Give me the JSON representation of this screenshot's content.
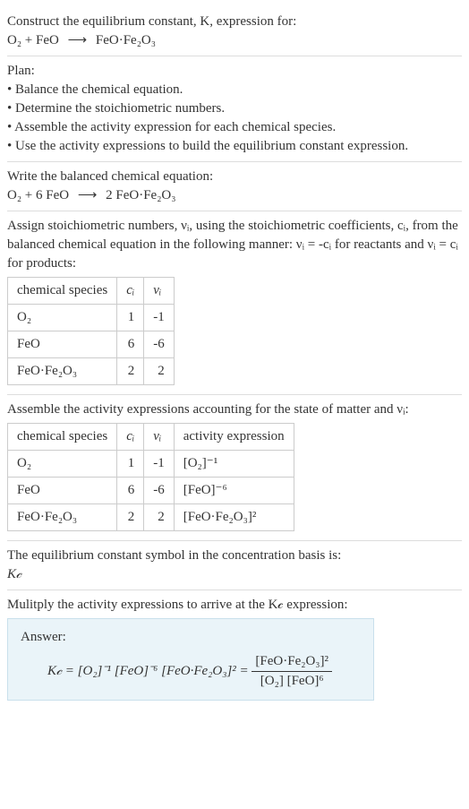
{
  "title": "Construct the equilibrium constant, K, expression for:",
  "unbalanced": {
    "left": "O₂ + FeO",
    "arrow": "⟶",
    "right": "FeO·Fe₂O₃"
  },
  "plan": {
    "heading": "Plan:",
    "items": [
      "• Balance the chemical equation.",
      "• Determine the stoichiometric numbers.",
      "• Assemble the activity expression for each chemical species.",
      "• Use the activity expressions to build the equilibrium constant expression."
    ]
  },
  "balanced": {
    "heading": "Write the balanced chemical equation:",
    "left": "O₂ + 6 FeO",
    "arrow": "⟶",
    "right": "2 FeO·Fe₂O₃"
  },
  "stoich": {
    "heading": "Assign stoichiometric numbers, νᵢ, using the stoichiometric coefficients, cᵢ, from the balanced chemical equation in the following manner: νᵢ = -cᵢ for reactants and νᵢ = cᵢ for products:",
    "cols": [
      "chemical species",
      "cᵢ",
      "νᵢ"
    ],
    "rows": [
      {
        "species": "O₂",
        "c": "1",
        "nu": "-1"
      },
      {
        "species": "FeO",
        "c": "6",
        "nu": "-6"
      },
      {
        "species": "FeO·Fe₂O₃",
        "c": "2",
        "nu": "2"
      }
    ]
  },
  "activity": {
    "heading": "Assemble the activity expressions accounting for the state of matter and νᵢ:",
    "cols": [
      "chemical species",
      "cᵢ",
      "νᵢ",
      "activity expression"
    ],
    "rows": [
      {
        "species": "O₂",
        "c": "1",
        "nu": "-1",
        "expr": "[O₂]⁻¹"
      },
      {
        "species": "FeO",
        "c": "6",
        "nu": "-6",
        "expr": "[FeO]⁻⁶"
      },
      {
        "species": "FeO·Fe₂O₃",
        "c": "2",
        "nu": "2",
        "expr": "[FeO·Fe₂O₃]²"
      }
    ]
  },
  "symbol": {
    "heading": "The equilibrium constant symbol in the concentration basis is:",
    "value": "K𝒸"
  },
  "multiply": {
    "heading": "Mulitply the activity expressions to arrive at the K𝒸 expression:"
  },
  "answer": {
    "label": "Answer:",
    "lhs": "K𝒸 = [O₂]⁻¹ [FeO]⁻⁶ [FeO·Fe₂O₃]² =",
    "frac_num": "[FeO·Fe₂O₃]²",
    "frac_den": "[O₂] [FeO]⁶"
  },
  "chart_data": {
    "type": "table",
    "tables": [
      {
        "title": "Stoichiometric numbers",
        "columns": [
          "chemical species",
          "c_i",
          "nu_i"
        ],
        "rows": [
          [
            "O2",
            1,
            -1
          ],
          [
            "FeO",
            6,
            -6
          ],
          [
            "FeO·Fe2O3",
            2,
            2
          ]
        ]
      },
      {
        "title": "Activity expressions",
        "columns": [
          "chemical species",
          "c_i",
          "nu_i",
          "activity expression"
        ],
        "rows": [
          [
            "O2",
            1,
            -1,
            "[O2]^-1"
          ],
          [
            "FeO",
            6,
            -6,
            "[FeO]^-6"
          ],
          [
            "FeO·Fe2O3",
            2,
            2,
            "[FeO·Fe2O3]^2"
          ]
        ]
      }
    ],
    "equilibrium_expression": "Kc = [FeO·Fe2O3]^2 / ([O2] [FeO]^6)"
  }
}
